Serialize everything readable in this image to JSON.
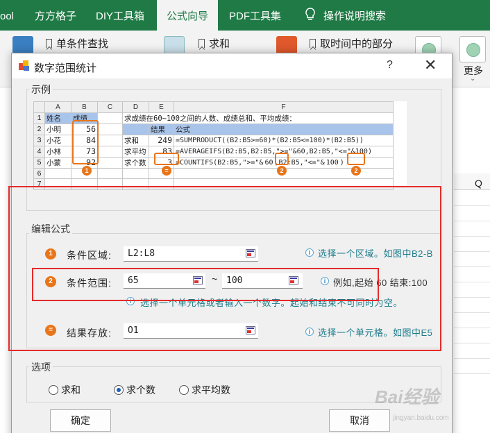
{
  "ribbon": {
    "tabs": [
      "ool",
      "方方格子",
      "DIY工具箱",
      "公式向导",
      "PDF工具集",
      "操作说明搜索"
    ],
    "commands": [
      "单条件查找",
      "求和",
      "取时间中的部分"
    ],
    "more_label": "更多"
  },
  "sheet": {
    "col_label": "Q"
  },
  "dialog": {
    "title": "数字范围统计",
    "help": "?",
    "close": "✕",
    "example": {
      "group_label": "示例",
      "col_headers": [
        "A",
        "B",
        "C",
        "D",
        "E",
        "F"
      ],
      "row_numbers": [
        "1",
        "2",
        "3",
        "4",
        "5",
        "6",
        "7"
      ],
      "a_col": [
        "姓名",
        "小明",
        "小花",
        "小林",
        "小蒙"
      ],
      "b_col": [
        "成绩",
        "56",
        "84",
        "73",
        "92"
      ],
      "description": "求成绩在60~100之间的人数、成绩总和、平均成绩：",
      "d_col": [
        "求和",
        "求平均",
        "求个数"
      ],
      "e_header": "结果",
      "f_header": "公式",
      "e_col": [
        "249",
        "83",
        "3"
      ],
      "f_col": [
        "=SUMPRODUCT((B2:B5>=60)*(B2:B5<=100)*(B2:B5))",
        "=AVERAGEIFS(B2:B5,B2:B5,\">=\"&60,B2:B5,\"<=\"&100)"
      ],
      "f5_a": "=COUNTIFS(B2:B5,\">=\"&",
      "f5_b": "60",
      "f5_c": ",B2:B5,\"<=\"&",
      "f5_d": "100",
      "f5_e": ")",
      "badges": [
        "1",
        "=",
        "2",
        "2"
      ]
    },
    "edit": {
      "group_label": "编辑公式",
      "step_icons": [
        "1",
        "2",
        "="
      ],
      "range_label": "条件区域:",
      "range_value": "L2:L8",
      "range_hint": "选择一个区域。如图中B2-B",
      "cond_label": "条件范围:",
      "start_value": "65",
      "tilde": "~",
      "end_value": "100",
      "cond_hint": "例如,起始 60 结束:100",
      "cond_hint2": "选择一个单元格或者输入一个数字。起始和结束不可同时为空。",
      "result_label": "结果存放:",
      "result_value": "O1",
      "result_hint": "选择一个单元格。如图中E5"
    },
    "options": {
      "group_label": "选项",
      "radios": [
        {
          "label": "求和",
          "selected": false
        },
        {
          "label": "求个数",
          "selected": true
        },
        {
          "label": "求平均数",
          "selected": false
        }
      ]
    },
    "ok_label": "确定",
    "cancel_label": "取消"
  },
  "watermark": {
    "main": "Bai经验",
    "sub": "jingyan.baidu.com"
  },
  "colors": {
    "ribbon_green": "#1f7a45",
    "highlight_orange": "#e8751a",
    "red_box": "#e52b2b",
    "header_blue": "#a9c4ea"
  }
}
